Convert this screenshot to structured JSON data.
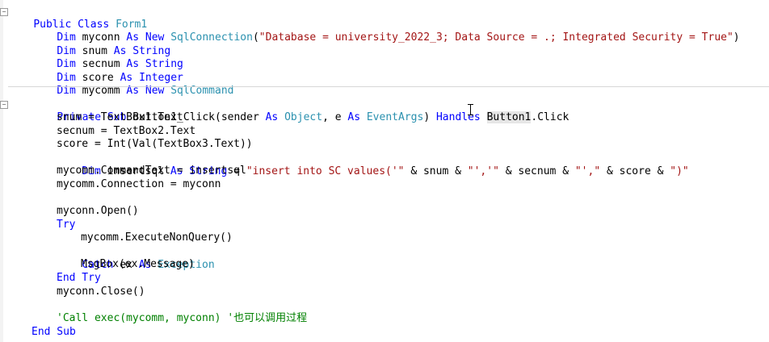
{
  "editor": {
    "lines": [
      [
        "Public",
        " ",
        "Class",
        " ",
        "Form1"
      ],
      [
        "Dim",
        " myconn ",
        "As",
        " ",
        "New",
        " ",
        "SqlConnection",
        "(",
        "\"Database = university_2022_3; Data Source = .; Integrated Security = True\"",
        ")"
      ],
      [
        "Dim",
        " snum ",
        "As",
        " ",
        "String"
      ],
      [
        "Dim",
        " secnum ",
        "As",
        " ",
        "String"
      ],
      [
        "Dim",
        " score ",
        "As",
        " ",
        "Integer"
      ],
      [
        "Dim",
        " mycomm ",
        "As",
        " ",
        "New",
        " ",
        "SqlCommand"
      ],
      [
        "Private",
        " ",
        "Sub",
        " Button1_Click(sender ",
        "As",
        " ",
        "Object",
        ", e ",
        "As",
        " ",
        "EventArgs",
        ") ",
        "Handles",
        " ",
        "Button1",
        ".Click"
      ],
      [
        "snum = TextBox1.Text"
      ],
      [
        "secnum = TextBox2.Text"
      ],
      [
        "score = Int(Val(TextBox3.Text))"
      ],
      [
        "Dim",
        " insertsql ",
        "As",
        " ",
        "String",
        " = ",
        "\"insert into SC values('\"",
        " & snum & ",
        "\"','\"",
        " & secnum & ",
        "\"',\"",
        " & score & ",
        "\")\""
      ],
      [
        "mycomm.CommandText = insertsql"
      ],
      [
        "mycomm.Connection = myconn"
      ],
      [
        "myconn.Open()"
      ],
      [
        "Try"
      ],
      [
        "mycomm.ExecuteNonQuery()"
      ],
      [
        "Catch",
        " ex ",
        "As",
        " ",
        "Exception"
      ],
      [
        "MsgBox(ex.Message)"
      ],
      [
        "End Try"
      ],
      [
        "myconn.Close()"
      ],
      [
        "'Call exec(mycomm, myconn) '也可以调用过程"
      ],
      [
        "End Sub"
      ]
    ]
  }
}
